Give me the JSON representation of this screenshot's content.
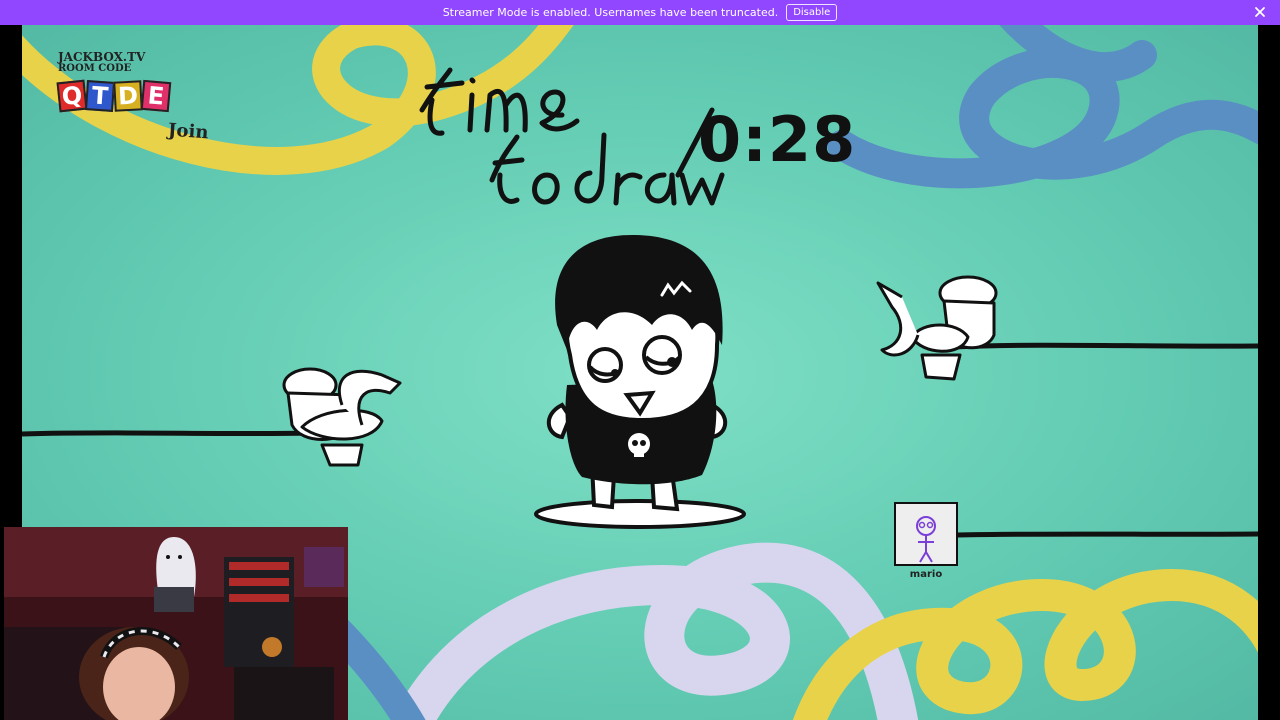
{
  "banner": {
    "message": "Streamer Mode is enabled. Usernames have been truncated.",
    "disable_label": "Disable"
  },
  "game": {
    "room": {
      "site": "JACKBOX.TV",
      "label": "ROOM CODE",
      "code_letters": [
        "Q",
        "T",
        "D",
        "E"
      ],
      "join": "Join"
    },
    "heading": "time to draw!",
    "timer": "0:28",
    "player": {
      "name": "mario"
    }
  },
  "colors": {
    "banner_bg": "#9146ff",
    "stage_bg": "#6cd3bb",
    "yellow_loop": "#e8d24a",
    "blue_loop": "#5a8fc4",
    "lavender_loop": "#d7d6ee",
    "code_letter_colors": [
      "#e02b2b",
      "#2f58cc",
      "#d6b020",
      "#e0306a"
    ]
  }
}
